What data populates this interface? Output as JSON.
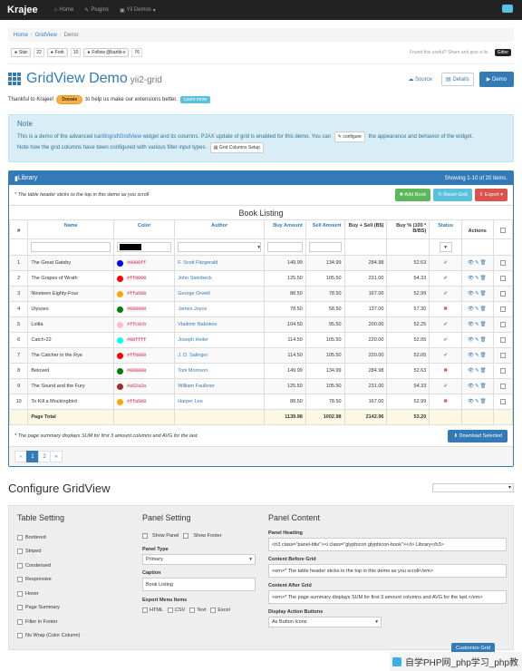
{
  "nav": {
    "brand": "Krajee",
    "items": [
      "Home",
      "Plugins",
      "Yii Demos"
    ]
  },
  "breadcrumb": [
    "Home",
    "GridView",
    "Demo"
  ],
  "social": {
    "star": "Star",
    "star_count": "22",
    "fork": "Fork",
    "fork_count": "10",
    "follow": "Follow @kartik-v",
    "follow_count": "76",
    "found": "Found this useful? Share and give a fix.",
    "gitter": "Gitter"
  },
  "page": {
    "title": "GridView Demo",
    "subtitle": "yii2-grid",
    "source": "Source",
    "details": "Details",
    "demo": "Demo"
  },
  "thanks": {
    "text1": "Thankful to Krajee!",
    "donate": "Donate",
    "text2": "to help us make our extensions better.",
    "learn": "Learn more"
  },
  "note": {
    "title": "Note",
    "line1a": "This is a demo of the advanced",
    "line1b": "kartik\\grid\\GridView",
    "line1c": "widget and its columns. PJAX update of grid is enabled for this demo. You can",
    "configure": "configure",
    "line1d": "the appearance and behavior of the widget.",
    "line2a": "Note how the grid columns have been configured with various filter input types.",
    "setup": "Grid Columns Setup"
  },
  "grid": {
    "heading": "Library",
    "summary": "Showing 1-10 of 20 items.",
    "before": "* The table header sticks to the top in this demo as you scroll",
    "add": "Add Book",
    "reset": "Reset Grid",
    "export": "Export",
    "caption": "Book Listing",
    "headers": [
      "#",
      "Name",
      "Color",
      "Author",
      "Buy Amount",
      "Sell Amount",
      "Buy + Sell (B$)",
      "Buy % (100 * B/BS)",
      "Status",
      "Actions"
    ],
    "rows": [
      [
        "1",
        "The Great Gatsby",
        "#0000ff",
        "F. Scott Fitzgerald",
        "149.99",
        "134.99",
        "284.98",
        "52.63",
        "ok"
      ],
      [
        "2",
        "The Grapes of Wrath",
        "#ff0000",
        "John Steinbeck",
        "125.50",
        "105.50",
        "231.00",
        "54.33",
        "ok"
      ],
      [
        "3",
        "Nineteen Eighty-Four",
        "#ffa500",
        "George Orwell",
        "88.50",
        "78.50",
        "167.00",
        "52.99",
        "ok"
      ],
      [
        "4",
        "Ulysses",
        "#008000",
        "James Joyce",
        "78.50",
        "58.50",
        "137.00",
        "57.30",
        "no"
      ],
      [
        "5",
        "Lolita",
        "#ffc0cb",
        "Vladimir Nabokov",
        "104.50",
        "95.50",
        "200.00",
        "52.25",
        "ok"
      ],
      [
        "6",
        "Catch-22",
        "#00ffff",
        "Joseph Heller",
        "114.50",
        "105.50",
        "220.00",
        "52.05",
        "ok"
      ],
      [
        "7",
        "The Catcher in the Rye",
        "#ff0000",
        "J. D. Salinger",
        "114.50",
        "105.50",
        "220.00",
        "52.05",
        "ok"
      ],
      [
        "8",
        "Beloved",
        "#008000",
        "Toni Morrison",
        "149.99",
        "134.99",
        "284.98",
        "52.63",
        "no"
      ],
      [
        "9",
        "The Sound and the Fury",
        "#a52a2a",
        "William Faulkner",
        "125.50",
        "105.50",
        "231.00",
        "54.33",
        "ok"
      ],
      [
        "10",
        "To Kill a Mockingbird",
        "#ffa500",
        "Harper Lee",
        "88.50",
        "78.50",
        "167.00",
        "52.99",
        "no"
      ]
    ],
    "total": {
      "label": "Page Total",
      "buy": "1139.98",
      "sell": "1002.98",
      "bs": "2142.96",
      "pct": "53.20"
    },
    "after": "* The page summary displays SUM for first 3 amount columns and AVG for the last.",
    "download": "Download Selected",
    "pages": [
      "«",
      "1",
      "2",
      "»"
    ]
  },
  "config": {
    "title": "Configure GridView",
    "table_setting": {
      "title": "Table Setting",
      "items": [
        "Bordered",
        "Striped",
        "Condensed",
        "Responsive",
        "Hover",
        "Page Summary",
        "Filter in Footer",
        "No Wrap (Color Column)"
      ]
    },
    "panel_setting": {
      "title": "Panel Setting",
      "show_panel": "Show Panel",
      "show_footer": "Show Footer",
      "panel_type_label": "Panel Type",
      "panel_type": "Primary",
      "caption_label": "Caption",
      "caption": "Book Listing",
      "export_label": "Export Menu Items",
      "exports": [
        "HTML",
        "CSV",
        "Text",
        "Excel"
      ]
    },
    "panel_content": {
      "title": "Panel Content",
      "heading_label": "Panel Heading",
      "heading": "<h3 class=\"panel-title\"><i class=\"glyphicon glyphicon-book\"></i>  Library</h3>",
      "before_label": "Content Before Grid",
      "before": "<em>* The table header sticks to the top in this demo as you scroll</em>",
      "after_label": "Content After Grid",
      "after": "<em>* The page summary displays SUM for first 3 amount columns and AVG for the last.</em>",
      "display_label": "Display Action Buttons",
      "display": "As Button Icons",
      "customize": "Customize Grid"
    }
  },
  "watermark": "自学PHP网_php学习_php教"
}
